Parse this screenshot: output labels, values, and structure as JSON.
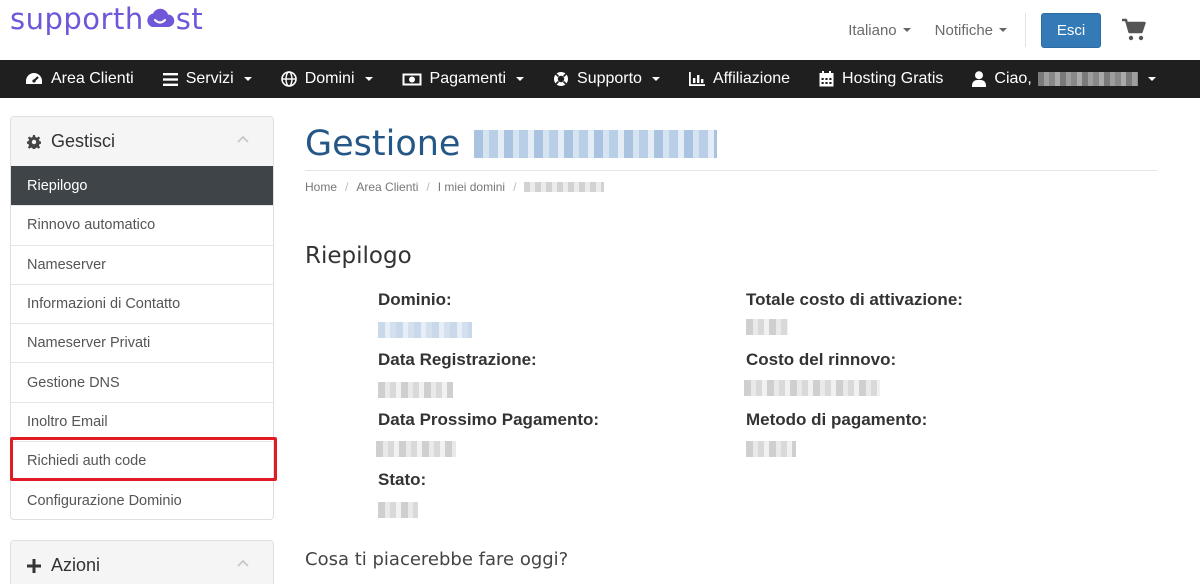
{
  "brand": {
    "name_left": "supporth",
    "name_right": "st",
    "color": "#6f57d8"
  },
  "top_bar": {
    "language": "Italiano",
    "notifications": "Notifiche",
    "logout": "Esci",
    "cart_icon": "cart-icon"
  },
  "navbar": {
    "items": [
      {
        "label": "Area Clienti",
        "icon": "dashboard-icon",
        "dropdown": false
      },
      {
        "label": "Servizi",
        "icon": "list-icon",
        "dropdown": true
      },
      {
        "label": "Domini",
        "icon": "globe-icon",
        "dropdown": true
      },
      {
        "label": "Pagamenti",
        "icon": "money-icon",
        "dropdown": true
      },
      {
        "label": "Supporto",
        "icon": "lifebuoy-icon",
        "dropdown": true
      },
      {
        "label": "Affiliazione",
        "icon": "bar-chart-icon",
        "dropdown": false
      },
      {
        "label": "Hosting Gratis",
        "icon": "calendar-icon",
        "dropdown": false
      }
    ],
    "user_greeting": "Ciao,"
  },
  "sidebar": {
    "manage_title": "Gestisci",
    "items": [
      {
        "label": "Riepilogo",
        "active": true
      },
      {
        "label": "Rinnovo automatico",
        "active": false
      },
      {
        "label": "Nameserver",
        "active": false
      },
      {
        "label": "Informazioni di Contatto",
        "active": false
      },
      {
        "label": "Nameserver Privati",
        "active": false
      },
      {
        "label": "Gestione DNS",
        "active": false
      },
      {
        "label": "Inoltro Email",
        "active": false
      },
      {
        "label": "Richiedi auth code",
        "active": false
      },
      {
        "label": "Configurazione Dominio",
        "active": false
      }
    ],
    "highlighted_item": "Richiedi auth code",
    "highlight_color": "#e01b24",
    "actions_title": "Azioni"
  },
  "main": {
    "title": "Gestione",
    "breadcrumb": [
      "Home",
      "Area Clienti",
      "I miei domini"
    ],
    "section_title": "Riepilogo",
    "fields_left": [
      "Dominio:",
      "Data Registrazione:",
      "Data Prossimo Pagamento:",
      "Stato:"
    ],
    "fields_right": [
      "Totale costo di attivazione:",
      "Costo del rinnovo:",
      "Metodo di pagamento:"
    ],
    "question": "Cosa ti piacerebbe fare oggi?"
  },
  "colors": {
    "navbar_bg": "#1f1f1f",
    "title_blue": "#245785",
    "button_blue": "#337ab7",
    "active_item_bg": "#3e4448"
  }
}
